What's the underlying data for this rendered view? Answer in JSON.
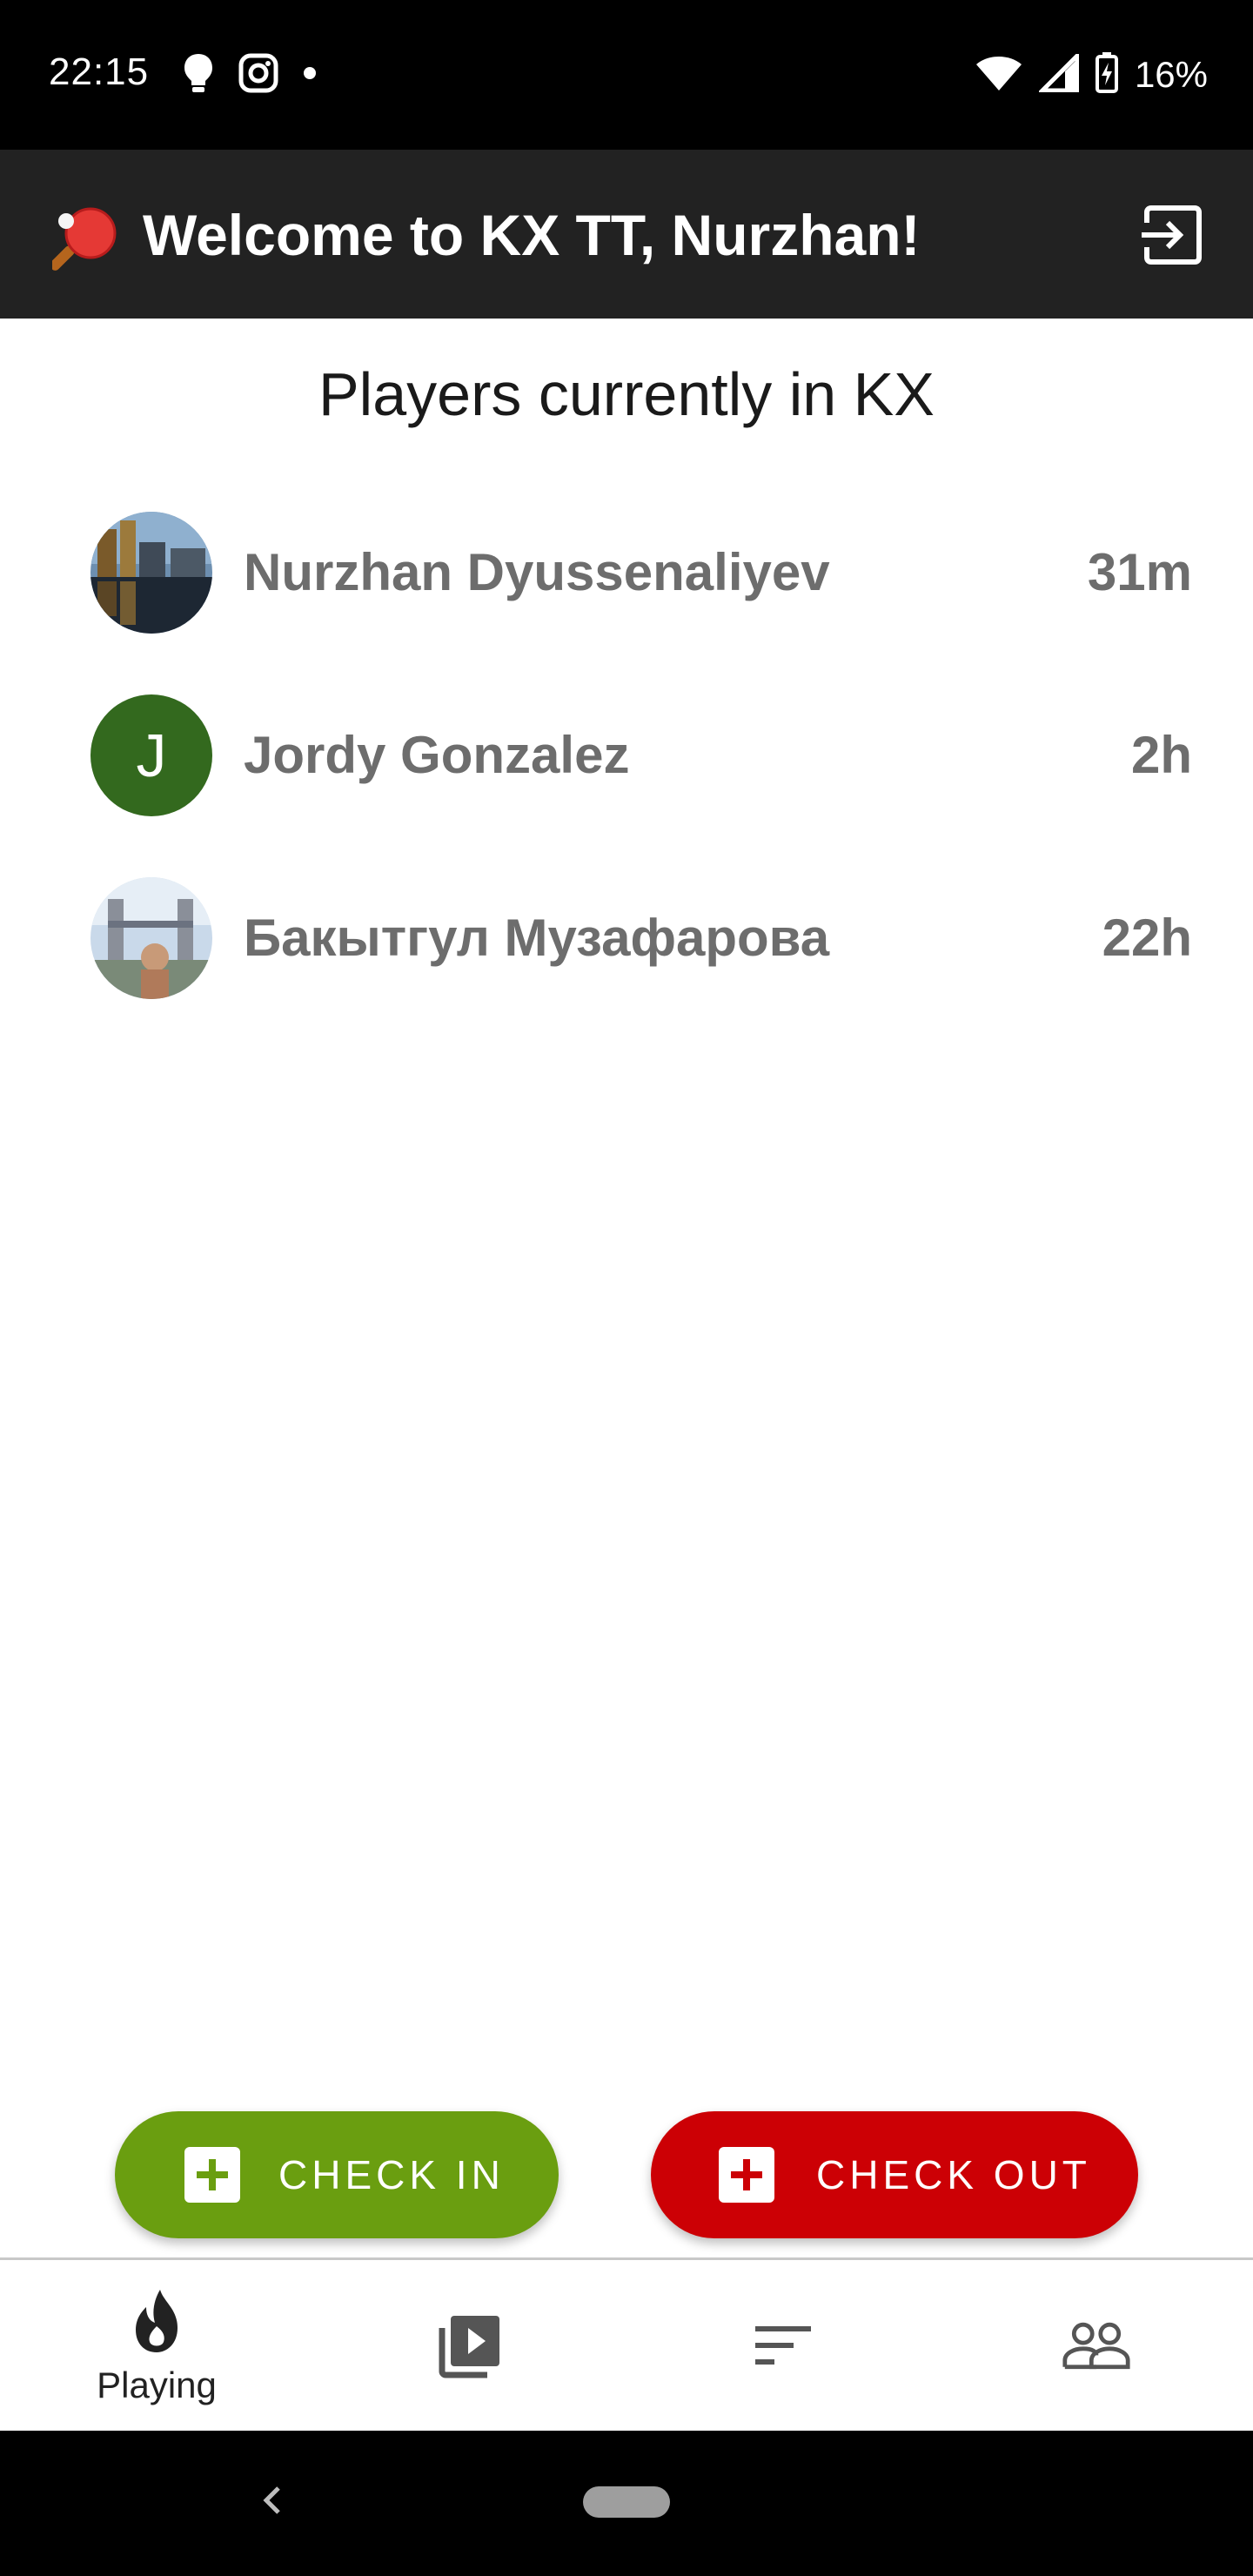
{
  "status_bar": {
    "time": "22:15",
    "left_icons": [
      "bulb-icon",
      "instagram-icon",
      "dot-icon"
    ],
    "battery_percent": "16%",
    "right_icons": [
      "wifi-icon",
      "signal-icon",
      "battery-charging-icon"
    ]
  },
  "app_bar": {
    "logo_icon": "ping-pong-icon",
    "title": "Welcome to KX TT, Nurzhan!",
    "logout_icon": "logout-icon"
  },
  "section": {
    "title": "Players currently in KX"
  },
  "players": [
    {
      "name": "Nurzhan Dyussenaliyev",
      "time": "31m",
      "avatar": "photo-city"
    },
    {
      "name": "Jordy Gonzalez",
      "time": "2h",
      "avatar_letter": "J",
      "avatar_color": "#33691e"
    },
    {
      "name": "Бакытгул Музафарова",
      "time": "22h",
      "avatar": "photo-bridge"
    }
  ],
  "actions": {
    "check_in_label": "CHECK IN",
    "check_out_label": "CHECK OUT",
    "check_in_color": "#6a9e10",
    "check_out_color": "#cc0005"
  },
  "bottom_nav": {
    "items": [
      {
        "icon": "flame-icon",
        "label": "Playing",
        "active": true
      },
      {
        "icon": "video-library-icon"
      },
      {
        "icon": "sort-icon"
      },
      {
        "icon": "people-icon"
      }
    ]
  }
}
